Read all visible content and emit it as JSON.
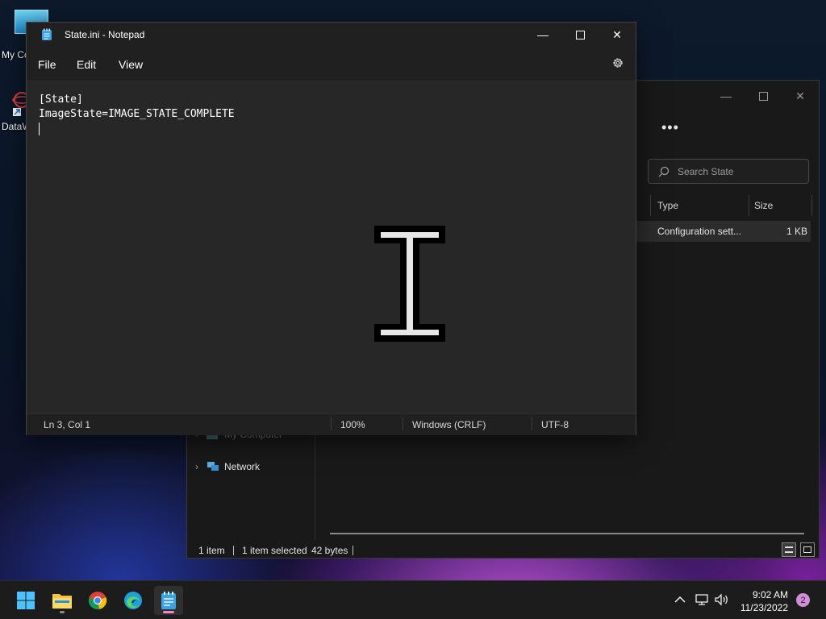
{
  "desktop": {
    "icons": [
      {
        "label": "My Co",
        "icon": "computer-icon"
      },
      {
        "label": "DataW",
        "icon": "datawedge-icon"
      }
    ]
  },
  "explorer": {
    "more_label": "•••",
    "search_placeholder": "Search State",
    "columns": {
      "type": "Type",
      "size": "Size"
    },
    "row": {
      "type": "Configuration sett...",
      "size": "1 KB"
    },
    "nav": {
      "my_computer": "My Computer",
      "network": "Network"
    },
    "status": {
      "items": "1 item",
      "selected": "1 item selected",
      "bytes": "42 bytes"
    }
  },
  "notepad": {
    "title": "State.ini - Notepad",
    "menu": {
      "file": "File",
      "edit": "Edit",
      "view": "View"
    },
    "content": {
      "line1": "[State]",
      "line2": "ImageState=IMAGE_STATE_COMPLETE"
    },
    "status": {
      "position": "Ln 3, Col 1",
      "zoom": "100%",
      "line_ending": "Windows (CRLF)",
      "encoding": "UTF-8"
    }
  },
  "taskbar": {
    "apps": [
      "start-icon",
      "file-explorer-icon",
      "chrome-icon",
      "edge-icon",
      "notepad-icon"
    ],
    "time": "9:02 AM",
    "date": "11/23/2022",
    "notification_count": "2"
  }
}
